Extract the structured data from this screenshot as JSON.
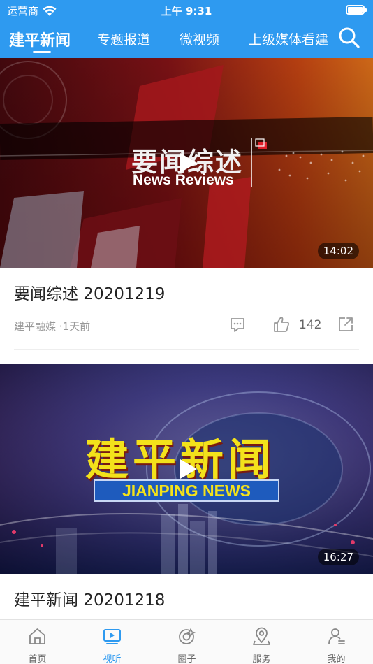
{
  "status_bar": {
    "carrier": "运营商",
    "time": "上午 9:31"
  },
  "top_tabs": [
    {
      "label": "建平新闻",
      "active": true
    },
    {
      "label": "专题报道",
      "active": false
    },
    {
      "label": "微视频",
      "active": false
    },
    {
      "label": "上级媒体看建",
      "active": false
    }
  ],
  "accent_color": "#2e9af0",
  "videos": [
    {
      "overlay_cn": "要闻综述",
      "overlay_en": "News Reviews",
      "duration": "14:02",
      "title": "要闻综述 20201219",
      "source": "建平融媒 ·1天前",
      "likes": "142"
    },
    {
      "overlay_cn": "建平新闻",
      "overlay_en": "JIANPING NEWS",
      "duration": "16:27",
      "title": "建平新闻 20201218"
    }
  ],
  "bottom_nav": [
    {
      "label": "首页",
      "icon": "home-icon",
      "active": false
    },
    {
      "label": "视听",
      "icon": "video-icon",
      "active": true
    },
    {
      "label": "圈子",
      "icon": "circle-icon",
      "active": false
    },
    {
      "label": "服务",
      "icon": "location-icon",
      "active": false
    },
    {
      "label": "我的",
      "icon": "user-icon",
      "active": false
    }
  ]
}
